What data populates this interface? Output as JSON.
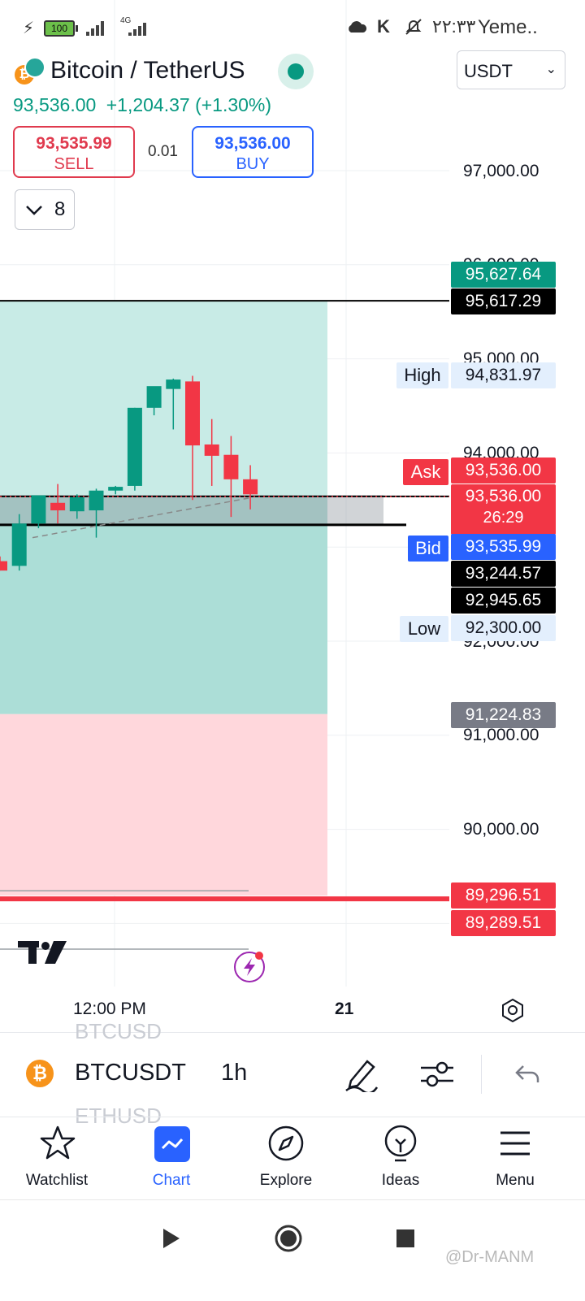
{
  "status_bar": {
    "battery": "100",
    "network": "4G",
    "time": "۲۲:۳۳",
    "carrier": "Yeme.."
  },
  "header": {
    "title": "Bitcoin / TetherUS",
    "price": "93,536.00",
    "change": "+1,204.37 (+1.30%)",
    "currency": "USDT",
    "sell": {
      "price": "93,535.99",
      "label": "SELL"
    },
    "buy": {
      "price": "93,536.00",
      "label": "BUY"
    },
    "quantity": "0.01",
    "indicator_count": "8"
  },
  "colors": {
    "up": "#089981",
    "down": "#f23645",
    "accent": "#2962ff",
    "tp_zone": "#c8ebe6",
    "sl_zone": "#ffd7dc"
  },
  "chart_data": {
    "type": "candlestick",
    "symbol": "BTCUSDT",
    "interval": "1h",
    "y_ticks": [
      "97,000.00",
      "96,000.00",
      "95,000.00",
      "94,000.00",
      "92,000.00",
      "91,000.00",
      "90,000.00"
    ],
    "ylim": [
      89100,
      97600
    ],
    "x_ticks": [
      "12:00 PM",
      "21"
    ],
    "price_tags": [
      {
        "value": "95,627.64",
        "color": "#089981"
      },
      {
        "value": "95,617.29",
        "color": "#000000"
      },
      {
        "value": "94,831.97",
        "label": "High",
        "color": "#e3effd"
      },
      {
        "value": "93,536.00",
        "label": "Ask",
        "color": "#f23645"
      },
      {
        "value": "93,536.00",
        "sub": "26:29",
        "color": "#f23645"
      },
      {
        "value": "93,535.99",
        "label": "Bid",
        "color": "#2962ff"
      },
      {
        "value": "93,244.57",
        "color": "#000000"
      },
      {
        "value": "92,945.65",
        "color": "#000000"
      },
      {
        "value": "92,300.00",
        "label": "Low",
        "color": "#e3effd"
      },
      {
        "value": "91,224.83",
        "color": "#787b86"
      },
      {
        "value": "89,296.51",
        "color": "#f23645"
      },
      {
        "value": "89,289.51",
        "color": "#f23645"
      }
    ],
    "candles": [
      {
        "o": 92850,
        "h": 92900,
        "l": 92750,
        "c": 92750
      },
      {
        "o": 92800,
        "h": 93350,
        "l": 92750,
        "c": 93250
      },
      {
        "o": 93250,
        "h": 93530,
        "l": 93200,
        "c": 93550
      },
      {
        "o": 93470,
        "h": 93670,
        "l": 93250,
        "c": 93390
      },
      {
        "o": 93380,
        "h": 93560,
        "l": 93300,
        "c": 93530
      },
      {
        "o": 93390,
        "h": 93620,
        "l": 93100,
        "c": 93600
      },
      {
        "o": 93600,
        "h": 93650,
        "l": 93560,
        "c": 93640
      },
      {
        "o": 93650,
        "h": 94480,
        "l": 93600,
        "c": 94480
      },
      {
        "o": 94480,
        "h": 94700,
        "l": 94400,
        "c": 94710
      },
      {
        "o": 94680,
        "h": 94790,
        "l": 94250,
        "c": 94780
      },
      {
        "o": 94760,
        "h": 94820,
        "l": 93500,
        "c": 94080
      },
      {
        "o": 94090,
        "h": 94360,
        "l": 93650,
        "c": 93970
      },
      {
        "o": 93980,
        "h": 94180,
        "l": 93320,
        "c": 93720
      },
      {
        "o": 93720,
        "h": 93870,
        "l": 93400,
        "c": 93560
      }
    ],
    "position": {
      "entry": 93244.57,
      "take_profit": 95617.29,
      "stop_loss": 89296.51,
      "target_boundary": 91224.83
    },
    "grid": true
  },
  "toolbar": {
    "symbol": "BTCUSDT",
    "interval": "1h",
    "ghost_above": "BTCUSD",
    "ghost_below": "ETHUSD"
  },
  "bottom_nav": [
    {
      "label": "Watchlist",
      "icon": "star-icon",
      "active": false
    },
    {
      "label": "Chart",
      "icon": "chart-icon",
      "active": true
    },
    {
      "label": "Explore",
      "icon": "compass-icon",
      "active": false
    },
    {
      "label": "Ideas",
      "icon": "lightbulb-icon",
      "active": false
    },
    {
      "label": "Menu",
      "icon": "menu-icon",
      "active": false
    }
  ],
  "watermark": "@Dr-MANM"
}
